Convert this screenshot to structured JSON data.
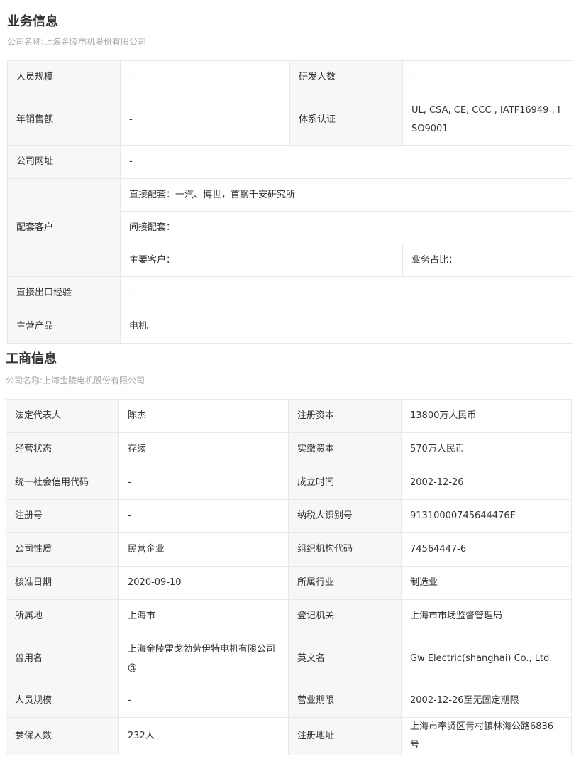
{
  "business": {
    "title": "业务信息",
    "subtitle": "公司名称:上海金陵电机股份有限公司",
    "staff_label": "人员规模",
    "staff_value": "-",
    "rd_label": "研发人数",
    "rd_value": "-",
    "sales_label": "年销售额",
    "sales_value": "-",
    "cert_label": "体系认证",
    "cert_value": "UL, CSA, CE, CCC , IATF16949 , ISO9001",
    "website_label": "公司网址",
    "website_value": "-",
    "customers_label": "配套客户",
    "direct_match": "直接配套：一汽、博世，首钢千安研究所",
    "indirect_match": "间接配套：",
    "main_customer": "主要客户：",
    "business_share": "业务占比：",
    "export_label": "直接出口经验",
    "export_value": "-",
    "product_label": "主营产品",
    "product_value": "电机"
  },
  "commerce": {
    "title": "工商信息",
    "subtitle": "公司名称:上海金陵电机股份有限公司",
    "rows": [
      {
        "l1": "法定代表人",
        "v1": "陈杰",
        "l2": "注册资本",
        "v2": "13800万人民币"
      },
      {
        "l1": "经营状态",
        "v1": "存续",
        "l2": "实缴资本",
        "v2": "570万人民币"
      },
      {
        "l1": "统一社会信用代码",
        "v1": "-",
        "l2": "成立时间",
        "v2": "2002-12-26"
      },
      {
        "l1": "注册号",
        "v1": "-",
        "l2": "纳税人识别号",
        "v2": "91310000745644476E"
      },
      {
        "l1": "公司性质",
        "v1": "民营企业",
        "l2": "组织机构代码",
        "v2": "74564447-6"
      },
      {
        "l1": "核准日期",
        "v1": "2020-09-10",
        "l2": "所属行业",
        "v2": "制造业"
      },
      {
        "l1": "所属地",
        "v1": "上海市",
        "l2": "登记机关",
        "v2": "上海市市场监督管理局"
      },
      {
        "l1": "曾用名",
        "v1": "上海金陵雷戈勃劳伊特电机有限公司@",
        "l2": "英文名",
        "v2": "Gw Electric(shanghai) Co., Ltd."
      },
      {
        "l1": "人员规模",
        "v1": "-",
        "l2": "营业期限",
        "v2": "2002-12-26至无固定期限"
      },
      {
        "l1": "参保人数",
        "v1": "232人",
        "l2": "注册地址",
        "v2": "上海市奉贤区青村镇林海公路6836号"
      }
    ]
  }
}
